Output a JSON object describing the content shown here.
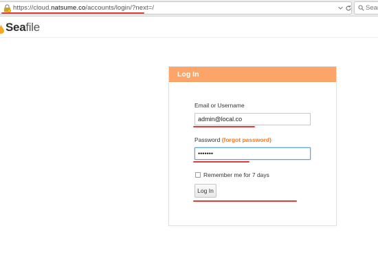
{
  "browser": {
    "url_prefix": "https://cloud.",
    "url_domain": "natsume.co",
    "url_path": "/accounts/login/?next=/",
    "search_placeholder": "Sear"
  },
  "site": {
    "logo_sea": "Sea",
    "logo_file": "file"
  },
  "login": {
    "title": "Log In",
    "username_label": "Email or Username",
    "username_value": "admin@local.co",
    "password_label": "Password",
    "forgot_label": "(forgot password)",
    "password_value": "•••••••",
    "remember_label": "Remember me for 7 days",
    "submit_label": "Log In"
  },
  "colors": {
    "panel_header": "#fba568",
    "annotation_red": "#e13c3c",
    "forgot_link": "#f07a26"
  }
}
